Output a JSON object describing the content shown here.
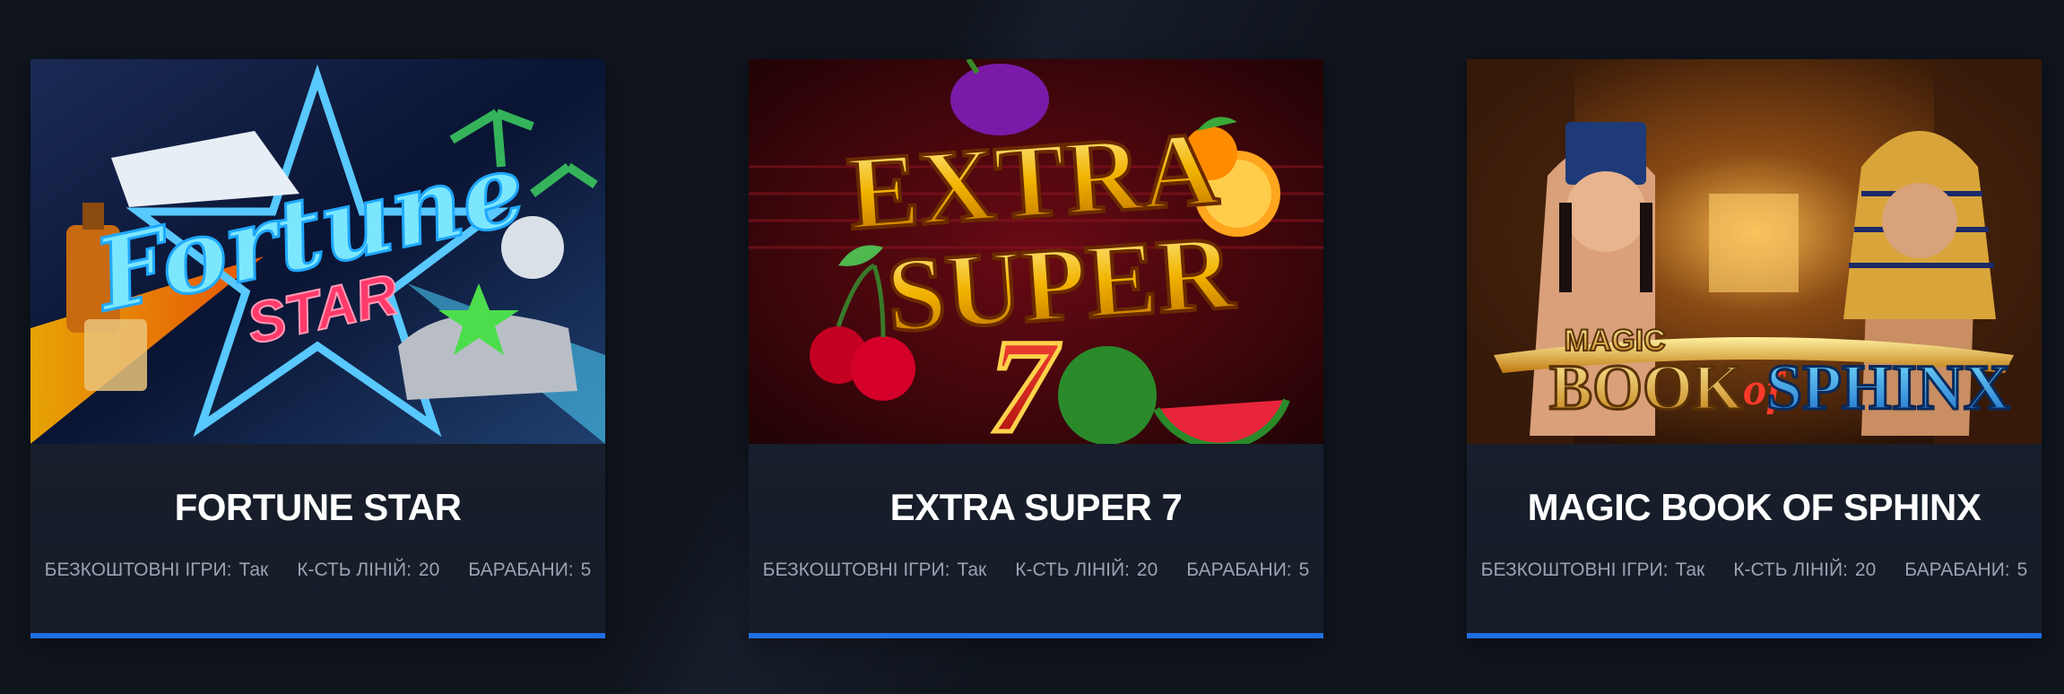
{
  "games": [
    {
      "title": "FORTUNE STAR",
      "art": {
        "text_main": "Fortune",
        "text_sub": "STAR"
      },
      "meta": [
        {
          "key": "БЕЗКОШТОВНІ ІГРИ:",
          "value": "Так"
        },
        {
          "key": "К-СТЬ ЛІНІЙ:",
          "value": "20"
        },
        {
          "key": "БАРАБАНИ:",
          "value": "5"
        }
      ]
    },
    {
      "title": "EXTRA SUPER 7",
      "art": {
        "text_main": "EXTRA",
        "text_sub": "SUPER",
        "text_num": "7"
      },
      "meta": [
        {
          "key": "БЕЗКОШТОВНІ ІГРИ:",
          "value": "Так"
        },
        {
          "key": "К-СТЬ ЛІНІЙ:",
          "value": "20"
        },
        {
          "key": "БАРАБАНИ:",
          "value": "5"
        }
      ]
    },
    {
      "title": "MAGIC BOOK OF SPHINX",
      "art": {
        "text_small": "MAGIC",
        "text_main": "BOOK",
        "text_of": "of",
        "text_sub": "SPHINX"
      },
      "meta": [
        {
          "key": "БЕЗКОШТОВНІ ІГРИ:",
          "value": "Так"
        },
        {
          "key": "К-СТЬ ЛІНІЙ:",
          "value": "20"
        },
        {
          "key": "БАРАБАНИ:",
          "value": "5"
        }
      ]
    }
  ],
  "colors": {
    "background": "#0f141d",
    "card": "#1b2231",
    "accent": "#1e6fe0",
    "title": "#ffffff",
    "meta": "#9aa3b2"
  }
}
